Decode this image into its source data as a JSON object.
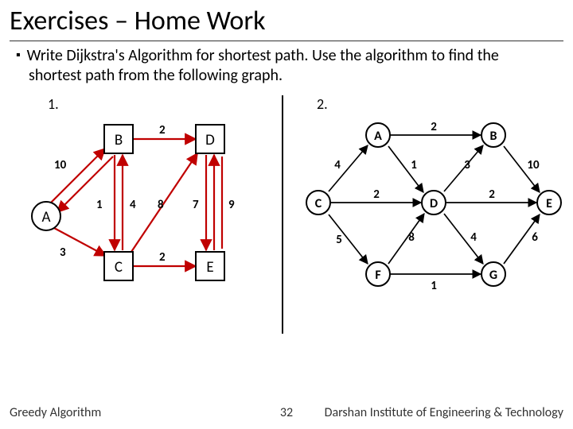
{
  "title": "Exercises – Home Work",
  "bullet": "Write Dijkstra's Algorithm for shortest path. Use the algorithm to find the shortest path from the following graph.",
  "num1": "1.",
  "num2": "2.",
  "graph1": {
    "nodes": {
      "A": "A",
      "B": "B",
      "C": "C",
      "D": "D",
      "E": "E"
    },
    "edges": {
      "AB10": "10",
      "BD2": "2",
      "BA1": "1",
      "BC4": "4",
      "CD8": "8",
      "DE7": "7",
      "DE9": "9",
      "AC3": "3",
      "CE2": "2"
    }
  },
  "graph2": {
    "nodes": {
      "A": "A",
      "B": "B",
      "C": "C",
      "D": "D",
      "E": "E",
      "F": "F",
      "G": "G"
    },
    "edges": {
      "AB2": "2",
      "CA4": "4",
      "AD1": "1",
      "DB3": "3",
      "BE10": "10",
      "CD2": "2",
      "DE2": "2",
      "CF5": "5",
      "FD8": "8",
      "DG4": "4",
      "GE6": "6",
      "FG1": "1"
    }
  },
  "footer": {
    "left": "Greedy Algorithm",
    "center": "32",
    "right": "Darshan Institute of Engineering & Technology"
  }
}
